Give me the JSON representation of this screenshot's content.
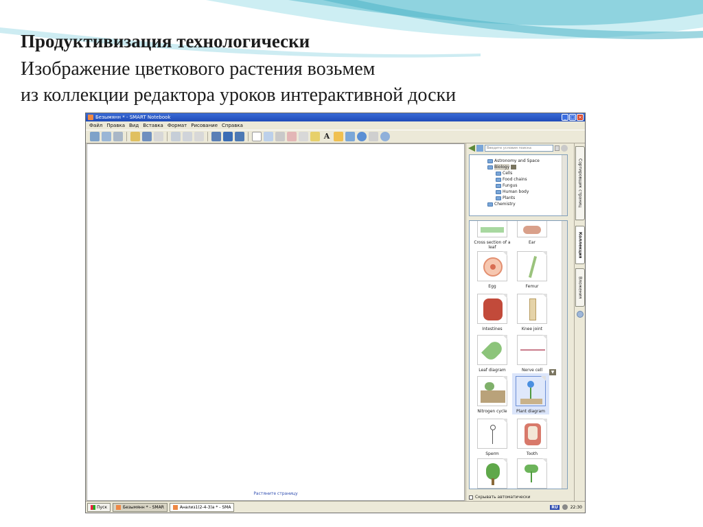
{
  "slide": {
    "title_line1": "Продуктивизация технологически",
    "title_line2": "Изображение цветкового растения возьмем",
    "title_line3": "из коллекции редактора уроков интерактивной доски"
  },
  "window": {
    "title": "Безымянн * - SMART Notebook",
    "menu": [
      "Файл",
      "Правка",
      "Вид",
      "Вставка",
      "Формат",
      "Рисование",
      "Справка"
    ]
  },
  "canvas": {
    "hint": "Растяните страницу"
  },
  "side_panel": {
    "search_placeholder": "Введите условия поиска",
    "tree": [
      {
        "label": "Astronomy and Space",
        "indent": 1
      },
      {
        "label": "Biology",
        "indent": 1
      },
      {
        "label": "Cells",
        "indent": 2
      },
      {
        "label": "Food chains",
        "indent": 2
      },
      {
        "label": "Fungus",
        "indent": 2
      },
      {
        "label": "Human body",
        "indent": 2
      },
      {
        "label": "Plants",
        "indent": 2
      },
      {
        "label": "Chemistry",
        "indent": 1
      }
    ],
    "gallery": [
      "Cross section of a leaf",
      "Ear",
      "Egg",
      "Femur",
      "Intestines",
      "Knee joint",
      "Leaf diagram",
      "Nerve cell",
      "Nitrogen cycle",
      "Plant diagram",
      "Sperm",
      "Tooth",
      "",
      ""
    ],
    "selected_item": "Plant diagram",
    "autohide_label": "Скрывать автоматически"
  },
  "tabs": [
    "Сортировщик страниц",
    "Коллекция",
    "Вложения"
  ],
  "taskbar": {
    "start": "Пуск",
    "tasks": [
      "Безымянн * - SMAR",
      "Анализ1(2-4-3)a * - SMA"
    ],
    "lang": "RU",
    "clock": "22:30"
  },
  "colors": {
    "titlebar": "#1f4bb8",
    "wave": "#8fd3df",
    "selection": "#dbe5fa"
  }
}
